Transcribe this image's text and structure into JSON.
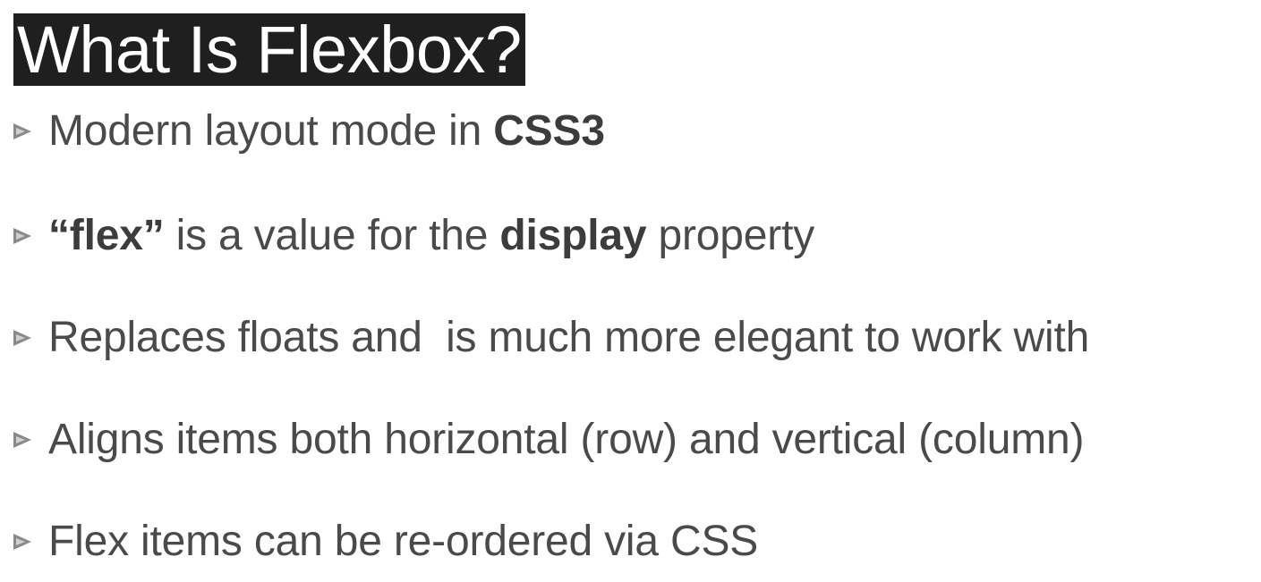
{
  "slide": {
    "title": "What Is Flexbox?",
    "bullets": [
      {
        "parts": [
          {
            "text": "Modern layout mode in ",
            "bold": false
          },
          {
            "text": "CSS3",
            "bold": true
          }
        ]
      },
      {
        "parts": [
          {
            "text": "“flex”",
            "bold": true
          },
          {
            "text": " is a value for the ",
            "bold": false
          },
          {
            "text": "display",
            "bold": true
          },
          {
            "text": " property",
            "bold": false
          }
        ]
      },
      {
        "parts": [
          {
            "text": "Replaces floats and  is much more elegant to work with",
            "bold": false
          }
        ]
      },
      {
        "parts": [
          {
            "text": "Aligns items both horizontal (row) and vertical (column)",
            "bold": false
          }
        ]
      },
      {
        "parts": [
          {
            "text": "Flex items can be re-ordered via CSS",
            "bold": false
          }
        ]
      }
    ],
    "bullet_icon": "triangle-bullet-icon",
    "colors": {
      "title_background": "#1f1f1f",
      "title_text": "#ffffff",
      "body_text": "#4a4a4a",
      "bullet_marker": "#8a8a8a"
    }
  }
}
